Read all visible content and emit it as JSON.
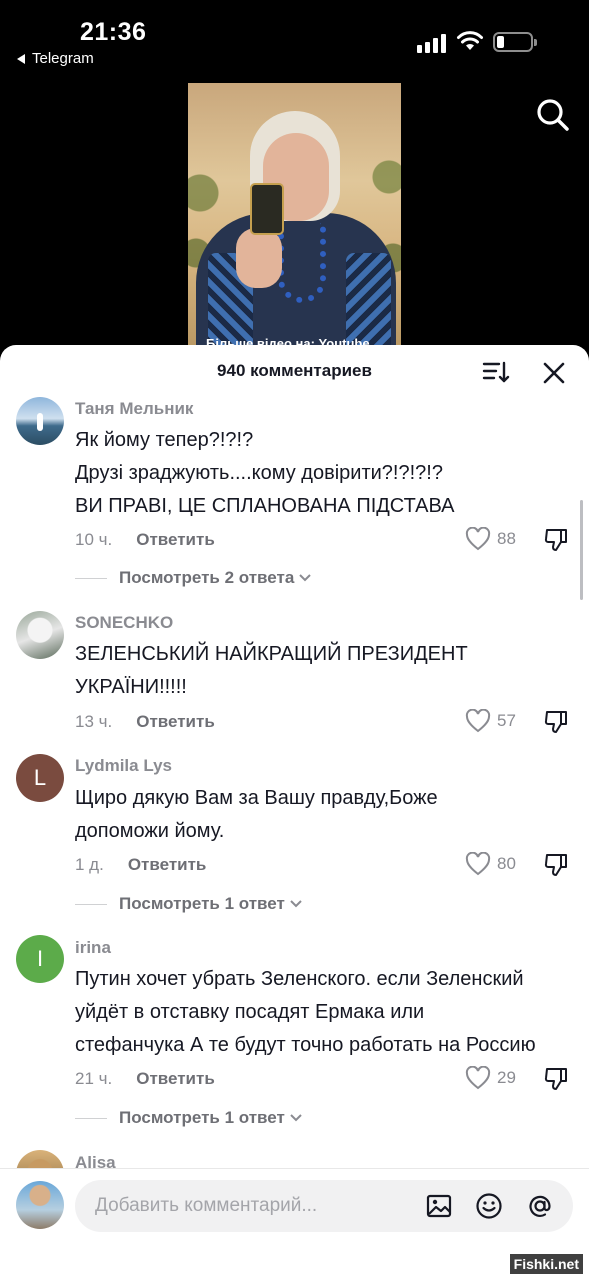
{
  "status_bar": {
    "time": "21:36",
    "back_app": "Telegram"
  },
  "video": {
    "caption": "Більше відео на: Youtube"
  },
  "comments_panel": {
    "count_title": "940 комментариев",
    "comments": [
      {
        "author": "Таня Мельник",
        "lines": [
          "Як йому тепер?!?!?",
          "Друзі зраджують....кому довірити?!?!?!?",
          "ВИ ПРАВІ, ЦЕ СПЛАНОВАНА ПІДСТАВА"
        ],
        "time": "10 ч.",
        "reply": "Ответить",
        "likes": "88",
        "view_replies": "Посмотреть 2 ответа"
      },
      {
        "author": "SONECHKO",
        "lines": [
          "ЗЕЛЕНСЬКИЙ НАЙКРАЩИЙ ПРЕЗИДЕНТ",
          "УКРАЇНИ!!!!!"
        ],
        "time": "13 ч.",
        "reply": "Ответить",
        "likes": "57"
      },
      {
        "author": "Lydmila Lys",
        "avatar_letter": "L",
        "lines": [
          "Щиро дякую Вам за Вашу правду,Боже",
          "допоможи йому."
        ],
        "time": "1 д.",
        "reply": "Ответить",
        "likes": "80",
        "view_replies": "Посмотреть 1 ответ"
      },
      {
        "author": "irina",
        "avatar_letter": "I",
        "lines": [
          "Путин хочет убрать Зеленского. если Зеленский",
          "уйдёт в отставку посадят Ермака или",
          "стефанчука А те будут точно работать на Россию"
        ],
        "time": "21 ч.",
        "reply": "Ответить",
        "likes": "29",
        "view_replies": "Посмотреть 1 ответ"
      },
      {
        "author": "Alisa"
      }
    ]
  },
  "input_bar": {
    "placeholder": "Добавить комментарий..."
  },
  "watermark": "Fishki.net",
  "colors": {
    "accent_green": "#5cab4a",
    "lydmila_avatar": "#7a4b3f",
    "text_primary": "#161823",
    "text_secondary": "#8a8b91"
  }
}
